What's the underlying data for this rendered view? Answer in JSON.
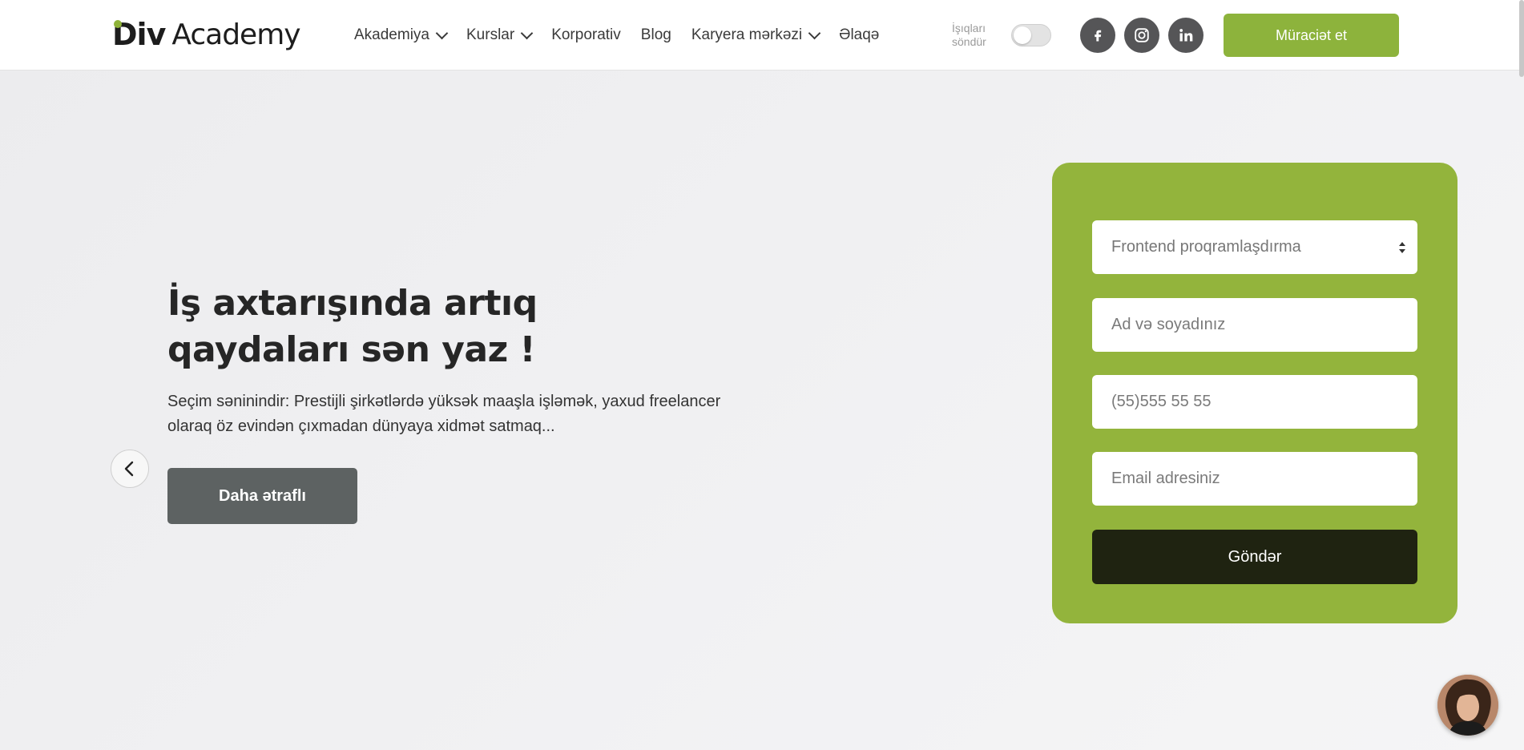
{
  "header": {
    "logo": {
      "part1": "Div",
      "part2": "Academy"
    },
    "nav": [
      {
        "label": "Akademiya",
        "dropdown": true
      },
      {
        "label": "Kurslar",
        "dropdown": true
      },
      {
        "label": "Korporativ",
        "dropdown": false
      },
      {
        "label": "Blog",
        "dropdown": false
      },
      {
        "label": "Karyera mərkəzi",
        "dropdown": true
      },
      {
        "label": "Əlaqə",
        "dropdown": false
      }
    ],
    "lights_toggle": {
      "line1": "İşıqları",
      "line2": "söndür",
      "on": false
    },
    "social_icons": [
      "facebook-icon",
      "instagram-icon",
      "linkedin-icon"
    ],
    "apply_button": "Müraciət et"
  },
  "hero": {
    "title_line1": "İş axtarışında artıq",
    "title_line2": "qaydaları sən yaz !",
    "description": "Seçim səninindir: Prestijli şirkətlərdə yüksək maaşla işləmək, yaxud freelancer olaraq öz evindən çıxmadan dünyaya xidmət satmaq...",
    "more_button": "Daha ətraflı",
    "prev_icon": "chevron-left-icon"
  },
  "form": {
    "course_select": {
      "value": "Frontend proqramlaşdırma"
    },
    "name_field": {
      "placeholder": "Ad və soyadınız"
    },
    "phone_field": {
      "placeholder": "(55)555 55 55"
    },
    "email_field": {
      "placeholder": "Email adresiniz"
    },
    "submit_button": "Göndər"
  },
  "colors": {
    "brand_green": "#8db33c",
    "form_green": "#93b43c",
    "submit_dark": "#1f2311",
    "more_button_gray": "#5d6262"
  }
}
